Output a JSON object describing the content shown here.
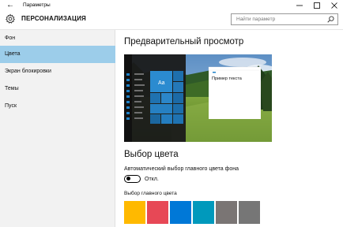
{
  "window": {
    "title": "Параметры",
    "back_icon": "back-arrow-icon",
    "controls": [
      "minimize-icon",
      "maximize-icon",
      "close-icon"
    ]
  },
  "header": {
    "icon": "gear-icon",
    "title": "ПЕРСОНАЛИЗАЦИЯ",
    "search": {
      "placeholder": "Найти параметр",
      "icon": "search-icon"
    }
  },
  "sidebar": {
    "items": [
      {
        "label": "Фон",
        "active": false
      },
      {
        "label": "Цвета",
        "active": true
      },
      {
        "label": "Экран блокировки",
        "active": false
      },
      {
        "label": "Темы",
        "active": false
      },
      {
        "label": "Пуск",
        "active": false
      }
    ],
    "active_color": "#9ccdea"
  },
  "main": {
    "preview": {
      "heading": "Предварительный просмотр",
      "tile_text": "Aa",
      "sample_text": "Пример текста",
      "accent": "#1e82c8"
    },
    "color_section": {
      "heading": "Выбор цвета",
      "auto_label": "Автоматический выбор главного цвета фона",
      "toggle_state": "Откл.",
      "toggle_on": false,
      "main_color_label": "Выбор главного цвета",
      "swatches": [
        "#ffb900",
        "#e74856",
        "#0078d7",
        "#0099bc",
        "#7a7574",
        "#767676"
      ]
    }
  }
}
